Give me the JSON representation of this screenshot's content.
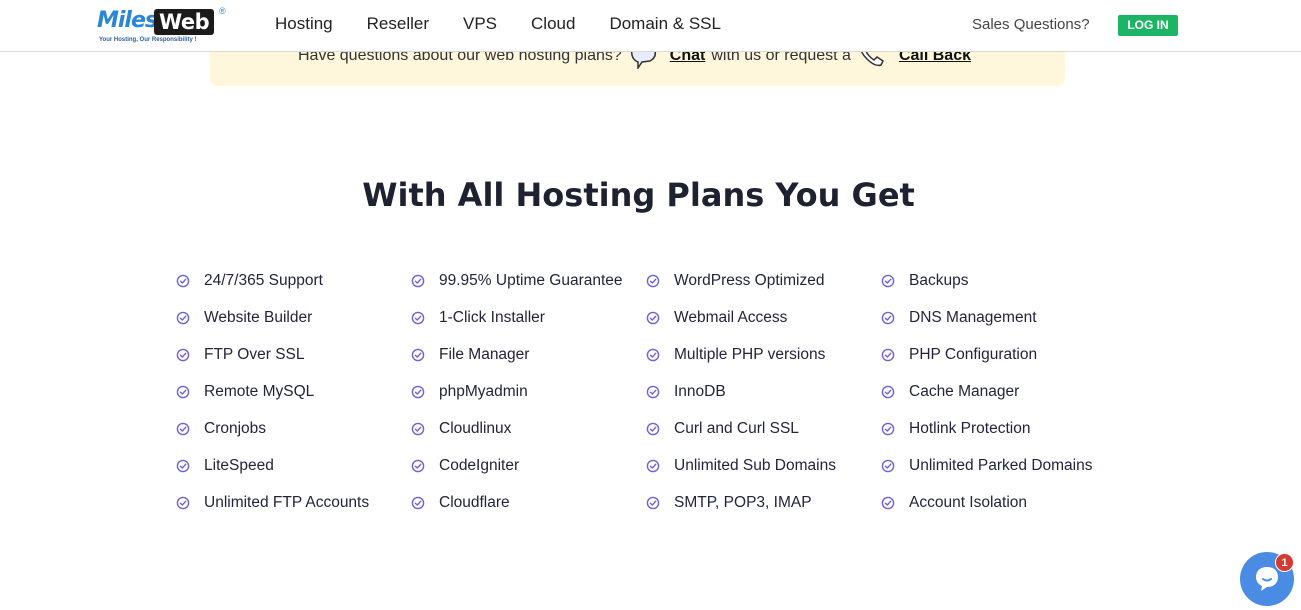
{
  "header": {
    "logo": {
      "brand_left": "Miles",
      "brand_right": "Web",
      "registered": "®",
      "tagline": "Your Hosting, Our Responsibility !"
    },
    "nav": [
      {
        "label": "Hosting"
      },
      {
        "label": "Reseller"
      },
      {
        "label": "VPS"
      },
      {
        "label": "Cloud"
      },
      {
        "label": "Domain & SSL"
      }
    ],
    "sales_label": "Sales Questions?",
    "login_label": "LOG IN",
    "login_color": "#1db565"
  },
  "banner": {
    "text_before": "Have questions about our web hosting plans?",
    "chat_link": "Chat",
    "text_middle": "with us or request a",
    "callback_link": "Call Back",
    "background": "#fef7dc"
  },
  "section": {
    "title": "With All Hosting Plans You Get",
    "check_icon_color": "#6c63d6",
    "columns": [
      [
        "24/7/365 Support",
        "Website Builder",
        "FTP Over SSL",
        "Remote MySQL",
        "Cronjobs",
        "LiteSpeed",
        "Unlimited FTP Accounts"
      ],
      [
        "99.95% Uptime Guarantee",
        "1-Click Installer",
        "File Manager",
        "phpMyadmin",
        "Cloudlinux",
        "CodeIgniter",
        "Cloudflare"
      ],
      [
        "WordPress Optimized",
        "Webmail Access",
        "Multiple PHP versions",
        "InnoDB",
        "Curl and Curl SSL",
        "Unlimited Sub Domains",
        "SMTP, POP3, IMAP"
      ],
      [
        "Backups",
        "DNS Management",
        "PHP Configuration",
        "Cache Manager",
        "Hotlink Protection",
        "Unlimited Parked Domains",
        "Account Isolation"
      ]
    ]
  },
  "chat_widget": {
    "badge_count": "1",
    "color": "#4a8be3",
    "badge_color": "#d33a32"
  }
}
